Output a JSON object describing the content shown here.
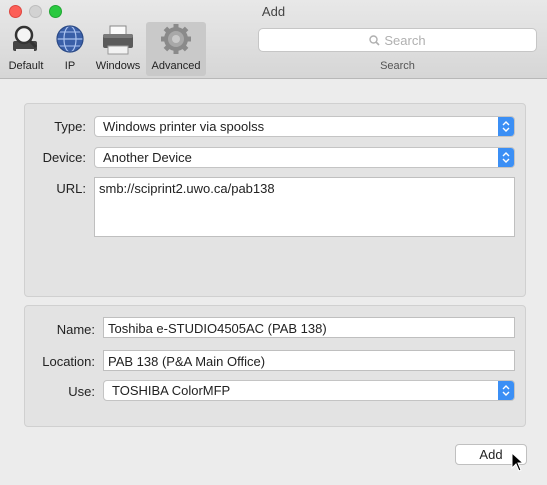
{
  "window": {
    "title": "Add"
  },
  "toolbar": {
    "items": [
      {
        "label": "Default",
        "icon": "magnifier-printer-icon"
      },
      {
        "label": "IP",
        "icon": "globe-icon"
      },
      {
        "label": "Windows",
        "icon": "printer-icon"
      },
      {
        "label": "Advanced",
        "icon": "gear-icon"
      }
    ],
    "active": "Advanced",
    "search_placeholder": "Search",
    "search_label": "Search"
  },
  "connection": {
    "type_label": "Type:",
    "type_value": "Windows printer via spoolss",
    "device_label": "Device:",
    "device_value": "Another Device",
    "url_label": "URL:",
    "url_value": "smb://sciprint2.uwo.ca/pab138"
  },
  "details": {
    "name_label": "Name:",
    "name_value": "Toshiba e-STUDIO4505AC (PAB 138)",
    "location_label": "Location:",
    "location_value": "PAB 138 (P&A Main Office)",
    "use_label": "Use:",
    "use_value": "TOSHIBA ColorMFP"
  },
  "footer": {
    "add_label": "Add"
  },
  "colors": {
    "accent": "#3b8ff5",
    "close": "#fc5f57",
    "zoom": "#2ac940"
  }
}
